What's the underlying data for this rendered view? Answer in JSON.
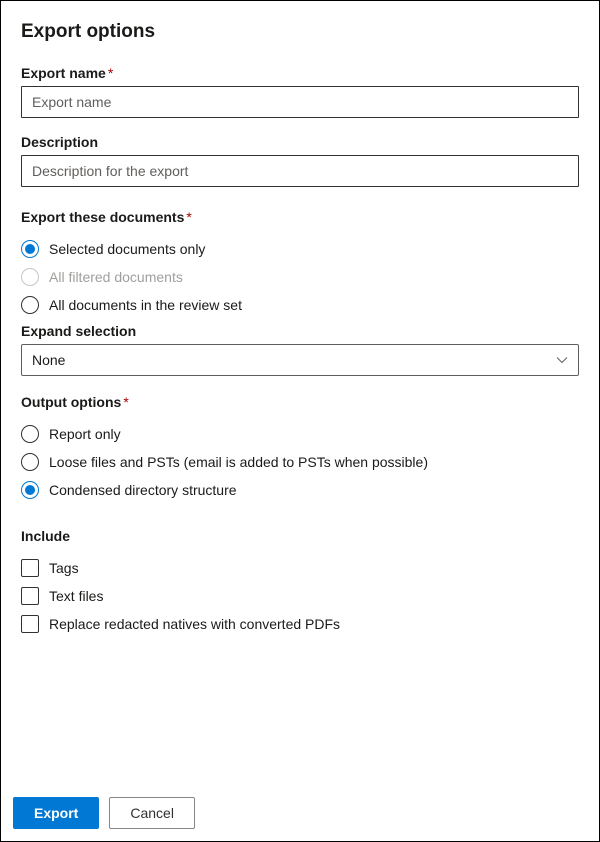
{
  "title": "Export options",
  "exportName": {
    "label": "Export name",
    "placeholder": "Export name"
  },
  "description": {
    "label": "Description",
    "placeholder": "Description for the export"
  },
  "exportDocs": {
    "label": "Export these documents",
    "options": {
      "selectedOnly": "Selected documents only",
      "allFiltered": "All filtered documents",
      "allInReviewSet": "All documents in the review set"
    }
  },
  "expandSelection": {
    "label": "Expand selection",
    "value": "None"
  },
  "outputOptions": {
    "label": "Output options",
    "options": {
      "reportOnly": "Report only",
      "loosePst": "Loose files and PSTs (email is added to PSTs when possible)",
      "condensed": "Condensed directory structure"
    }
  },
  "include": {
    "label": "Include",
    "options": {
      "tags": "Tags",
      "textFiles": "Text files",
      "replaceRedacted": "Replace redacted natives with converted PDFs"
    }
  },
  "buttons": {
    "export": "Export",
    "cancel": "Cancel"
  }
}
